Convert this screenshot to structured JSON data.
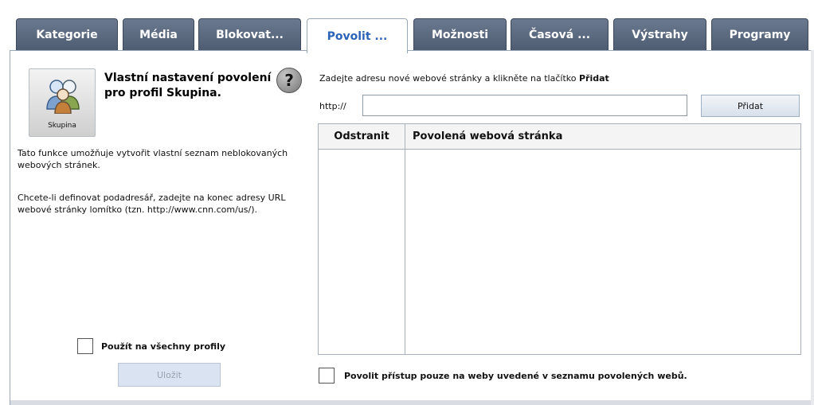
{
  "tabs": [
    {
      "label": "Kategorie",
      "active": false
    },
    {
      "label": "Média",
      "active": false
    },
    {
      "label": "Blokovat...",
      "active": false
    },
    {
      "label": "Povolit ...",
      "active": true
    },
    {
      "label": "Možnosti",
      "active": false
    },
    {
      "label": "Časová ...",
      "active": false
    },
    {
      "label": "Výstrahy",
      "active": false
    },
    {
      "label": "Programy",
      "active": false
    }
  ],
  "profile": {
    "tile_label": "Skupina",
    "title": "Vlastní nastavení povolení pro profil Skupina."
  },
  "help_icon_glyph": "?",
  "description": {
    "p1": "Tato funkce umožňuje vytvořit vlastní seznam neblokovaných webových stránek.",
    "p2": "Chcete-li definovat podadresář, zadejte na konec adresy URL webové stránky lomítko (tzn. http://www.cnn.com/us/)."
  },
  "instructions": {
    "text": "Zadejte adresu nové webové stránky a klikněte na tlačítko ",
    "bold": "Přidat"
  },
  "url": {
    "prefix": "http://",
    "value": "",
    "placeholder": ""
  },
  "buttons": {
    "add": "Přidat",
    "save": "Uložit"
  },
  "table": {
    "columns": [
      "Odstranit",
      "Povolená webová stránka"
    ],
    "rows": []
  },
  "checkboxes": {
    "apply_all": {
      "label": "Použít na všechny profily",
      "checked": false
    },
    "allow_only": {
      "label": "Povolit přístup pouze na weby uvedené v seznamu povolených webů.",
      "checked": false
    }
  },
  "colors": {
    "tab_inactive": "#5b6a80",
    "tab_active_text": "#2a63b7",
    "save_disabled_bg": "#d9e3f1"
  }
}
